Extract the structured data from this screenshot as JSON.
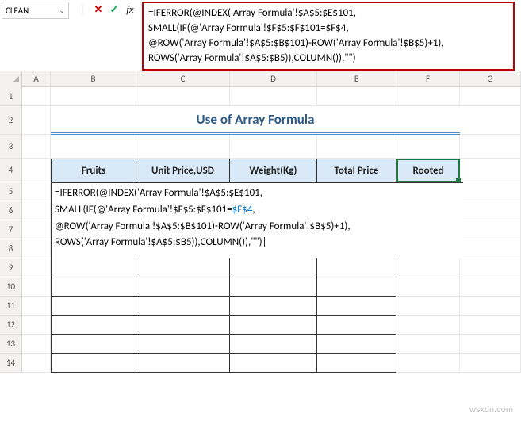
{
  "namebox": {
    "value": "CLEAN"
  },
  "formula_bar": {
    "line1": "=IFERROR(@INDEX('Array Formula'!$A$5:$E$101,",
    "line2": "SMALL(IF(@'Array Formula'!$F$5:$F$101=$F$4,",
    "line3": "@ROW('Array Formula'!$A$5:$B$101)-ROW('Array Formula'!$B$5)+1),",
    "line4": "ROWS('Array Formula'!$A$5:$B5)),COLUMN()),\"\")"
  },
  "columns": {
    "A": "A",
    "B": "B",
    "C": "C",
    "D": "D",
    "E": "E",
    "F": "F",
    "G": "G"
  },
  "rows": [
    "1",
    "2",
    "3",
    "4",
    "5",
    "6",
    "7",
    "8",
    "9",
    "10",
    "11",
    "12",
    "13",
    "14"
  ],
  "title": "Use of Array Formula",
  "table_headers": {
    "fruits": "Fruits",
    "unit_price": "Unit Price,USD",
    "weight": "Weight(Kg)",
    "total_price": "Total Price",
    "rooted": "Rooted"
  },
  "cell_formula": {
    "line1": "=IFERROR(@INDEX('Array Formula'!$A$5:$E$101,",
    "line2_pre": "SMALL(IF(@'Array Formula'!$F$5:$F$101=",
    "line2_ref": "$F$4",
    "line2_post": ",",
    "line3": "@ROW('Array Formula'!$A$5:$B$101)-ROW('Array Formula'!$B$5)+1),",
    "line4": "ROWS('Array Formula'!$A$5:$B5)),COLUMN()),\"\")|"
  },
  "icons": {
    "fx": "fx",
    "cancel": "✕",
    "accept": "✓",
    "dropdown": "⌄"
  },
  "watermark": "wsxdn.com"
}
